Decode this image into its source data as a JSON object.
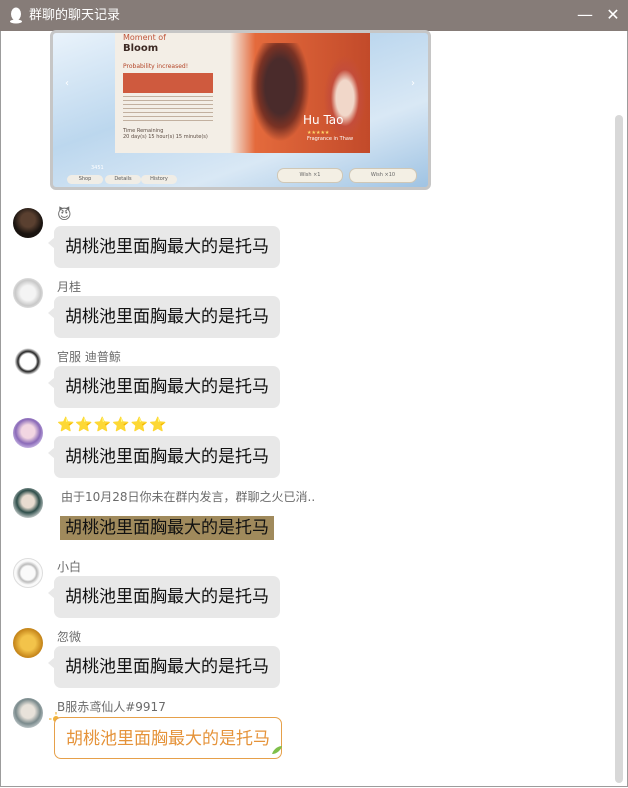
{
  "window": {
    "title": "群聊的聊天记录",
    "minimize_glyph": "—",
    "close_glyph": "✕"
  },
  "banner": {
    "title_small": "Moment of",
    "title_big": "Bloom",
    "probability": "Probability increased!",
    "time_label": "Time Remaining",
    "time_value": "20 day(s) 15 hour(s) 15 minute(s)",
    "character_name": "Hu Tao",
    "character_subtitle": "Fragrance in Thaw",
    "stars": "★★★★★",
    "buttons": [
      "Shop",
      "Details",
      "History"
    ],
    "wish1": "Wish ×1",
    "wish10": "Wish ×10",
    "primogems": "3451"
  },
  "messages": [
    {
      "name": "😈",
      "text": "胡桃池里面胸最大的是托马"
    },
    {
      "name": "月桂",
      "text": "胡桃池里面胸最大的是托马"
    },
    {
      "name": "官服 迪普鲸",
      "text": "胡桃池里面胸最大的是托马"
    },
    {
      "name": "⭐⭐⭐⭐⭐⭐",
      "text": "胡桃池里面胸最大的是托马"
    },
    {
      "name": "由于10月28日你未在群内发言，群聊之火已消..",
      "text": "胡桃池里面胸最大的是托马"
    },
    {
      "name": "小白",
      "text": "胡桃池里面胸最大的是托马"
    },
    {
      "name": "忽微",
      "text": "胡桃池里面胸最大的是托马"
    },
    {
      "name": "B服赤鸢仙人#9917",
      "text": "胡桃池里面胸最大的是托马"
    }
  ],
  "colors": {
    "titlebar": "#867c78",
    "bubble": "#e8e8e8",
    "gold_bubble": "#a08a5c",
    "special_border": "#e6a04a"
  }
}
